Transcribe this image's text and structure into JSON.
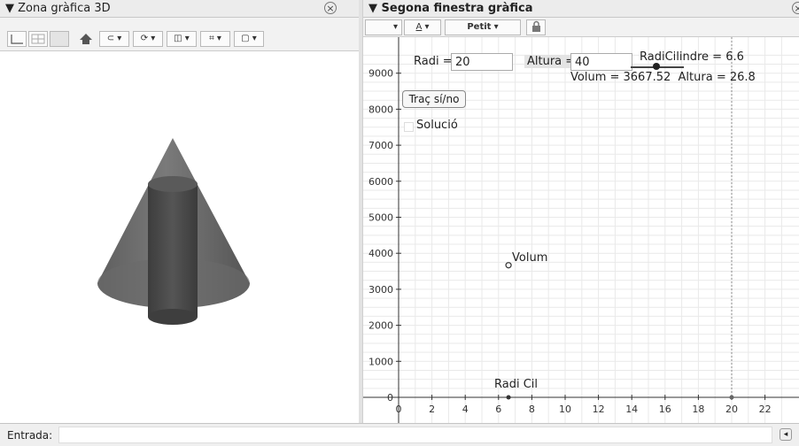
{
  "left_panel": {
    "title": "▼ Zona gràfica 3D",
    "close_icon": "close-circle-icon",
    "toolbar_buttons": [
      "axes-toggle",
      "grid-toggle",
      "plane-toggle",
      "home-icon",
      "rotate-view-dropdown",
      "animate-dropdown",
      "view-dropdown",
      "clip-dropdown",
      "projection-dropdown"
    ]
  },
  "right_panel": {
    "title": "▼ Segona finestra gràfica",
    "style_bar": {
      "color_dropdown": "",
      "text_style": "A",
      "size_label": "Petit",
      "lock_icon": "lock-icon"
    },
    "inputs": {
      "radi_label": "Radi =",
      "radi_value": "20",
      "altura_label": "Altura =",
      "altura_value": "40"
    },
    "slider_label": "RadiCilindre = 6.6",
    "result_text": "Volum = 3667.52  Altura = 26.8",
    "trace_button": "Traç sí/no",
    "solution_checkbox": "Solució",
    "point_label": "Volum",
    "axis_point_label": "Radi Cil",
    "chart_data": {
      "type": "scatter",
      "xlim": [
        -0.5,
        23
      ],
      "ylim": [
        -150,
        9300
      ],
      "x_ticks": [
        0,
        2,
        4,
        6,
        8,
        10,
        12,
        14,
        16,
        18,
        20,
        22
      ],
      "y_ticks": [
        0,
        1000,
        2000,
        3000,
        4000,
        5000,
        6000,
        7000,
        8000,
        9000
      ],
      "points": [
        {
          "name": "Volum",
          "x": 6.6,
          "y": 3667.52
        },
        {
          "name": "Radi Cil",
          "x": 6.6,
          "y": 0
        }
      ],
      "vertical_line_x": 20,
      "grid": true
    }
  },
  "input_bar": {
    "label": "Entrada:",
    "value": ""
  },
  "colors": {
    "cone": "#6b6b6b",
    "cylinder": "#4a4a4a",
    "grid": "#e9e9e9"
  }
}
